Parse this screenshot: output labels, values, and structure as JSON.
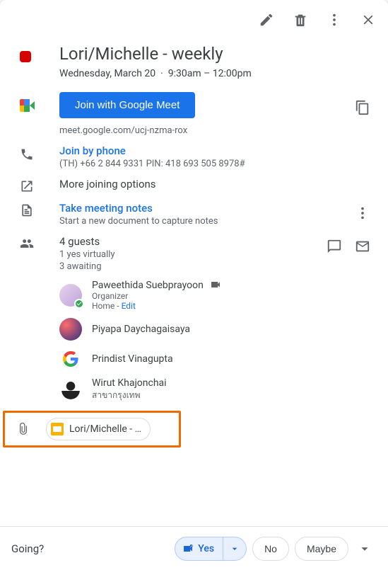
{
  "colors": {
    "accent": "#1a73e8",
    "eventColor": "#d50000",
    "highlight": "#ed6c02"
  },
  "event": {
    "title": "Lori/Michelle - weekly",
    "date": "Wednesday, March 20",
    "time_sep": "·",
    "time": "9:30am – 12:00pm"
  },
  "meet": {
    "join_label": "Join with Google Meet",
    "link": "meet.google.com/ucj-nzma-rox"
  },
  "phone": {
    "label": "Join by phone",
    "detail": "(TH) +66 2 844 9331 PIN: 418 693 505 8978#"
  },
  "more_join": "More joining options",
  "notes": {
    "title": "Take meeting notes",
    "sub": "Start a new document to capture notes"
  },
  "guests": {
    "summary": "4 guests",
    "sub1": "1 yes virtually",
    "sub2": "3 awaiting",
    "list": [
      {
        "name": "Paweethida Suebprayoon",
        "sub1": "Organizer",
        "sub2_prefix": "Home - ",
        "sub2_edit": "Edit",
        "hasVideo": true,
        "accepted": true
      },
      {
        "name": "Piyapa Daychagaisaya"
      },
      {
        "name": "Prindist Vinagupta"
      },
      {
        "name": "Wirut Khajonchai",
        "sub1": "สาขากรุงเทพ"
      }
    ]
  },
  "attachment": {
    "label": "Lori/Michelle - …"
  },
  "rsvp": {
    "question": "Going?",
    "yes": "Yes",
    "no": "No",
    "maybe": "Maybe"
  }
}
